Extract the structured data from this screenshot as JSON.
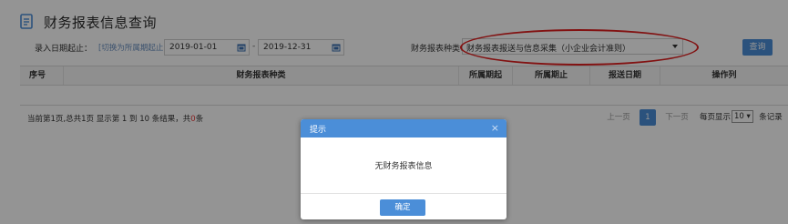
{
  "page": {
    "title": "财务报表信息查询",
    "date_label": "录入日期起止：",
    "date_hint": "[切换为所属期起止]",
    "date_start": "2019-01-01",
    "date_sep": "-",
    "date_end": "2019-12-31",
    "type_label": "财务报表种类：",
    "type_selected": "财务报表报送与信息采集（小企业会计准则）",
    "search_label": "查询"
  },
  "table": {
    "headers": [
      "序号",
      "财务报表种类",
      "所属期起",
      "所属期止",
      "报送日期",
      "操作列"
    ]
  },
  "pager": {
    "summary_prefix": "当前第1页,总共1页    显示第 1 到 10 条结果，共",
    "summary_count": "0",
    "summary_suffix": "条",
    "prev_label": "上一页",
    "current_page": "1",
    "next_label": "下一页",
    "size_label": "每页显示",
    "size_value": "10",
    "size_suffix": "条记录"
  },
  "modal": {
    "title": "提示",
    "close_glyph": "×",
    "message": "无财务报表信息",
    "ok_label": "确定"
  },
  "colors": {
    "accent": "#4b8ed8",
    "annotation": "#e02020"
  }
}
